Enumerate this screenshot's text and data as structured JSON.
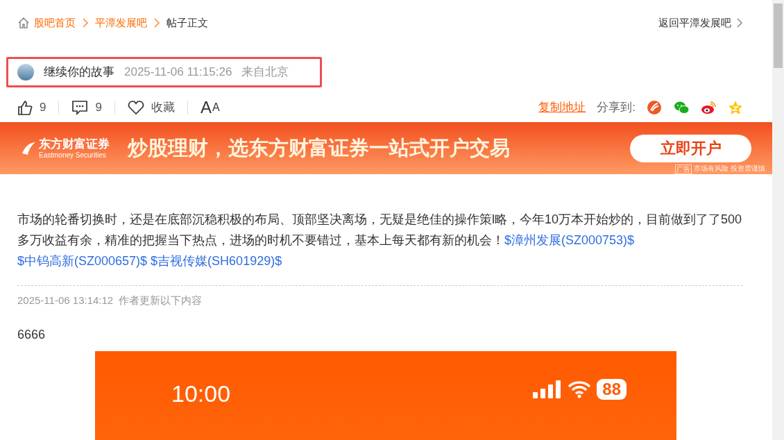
{
  "breadcrumb": {
    "items": [
      {
        "label": "股吧首页",
        "kind": "link"
      },
      {
        "label": "平潭发展吧",
        "kind": "link"
      },
      {
        "label": "帖子正文",
        "kind": "current"
      }
    ],
    "back_link": "返回平潭发展吧"
  },
  "author": {
    "name": "继续你的故事",
    "time": "2025-11-06 11:15:26",
    "location": "来自北京"
  },
  "actions": {
    "like_count": "9",
    "comment_count": "9",
    "favorite_label": "收藏",
    "font_large": "A",
    "font_small": "A"
  },
  "share": {
    "copy_link": "复制地址",
    "label": "分享到:"
  },
  "banner": {
    "brand": "东方财富证券",
    "brand_en": "Eastmoney Securities",
    "slogan": "炒股理财，选东方财富证券一站式开户交易",
    "button": "立即开户",
    "ad_tag": "广告",
    "disclaimer": "市场有风险 投资需谨慎"
  },
  "post": {
    "segments": [
      {
        "kind": "text",
        "text": "市场的轮番切换时，还是在底部沉稳积极的布局、顶部坚决离场，无疑是绝佳的操作策l略，今年10万本开始炒的，目前做到了了500多万收益有余，精准的把握当下热点，进场的时机不要错过，基本上每天都有新的机会！"
      },
      {
        "kind": "link",
        "text": "$漳州发展(SZ000753)$"
      },
      {
        "kind": "link",
        "text": "$中钨高新(SZ000657)$"
      },
      {
        "kind": "link",
        "text": "$吉视传媒(SH601929)$"
      }
    ]
  },
  "update": {
    "time": "2025-11-06 13:14:12",
    "label": "作者更新以下内容",
    "content": "6666"
  },
  "screenshot": {
    "status_time": "10:00",
    "battery": "88"
  }
}
